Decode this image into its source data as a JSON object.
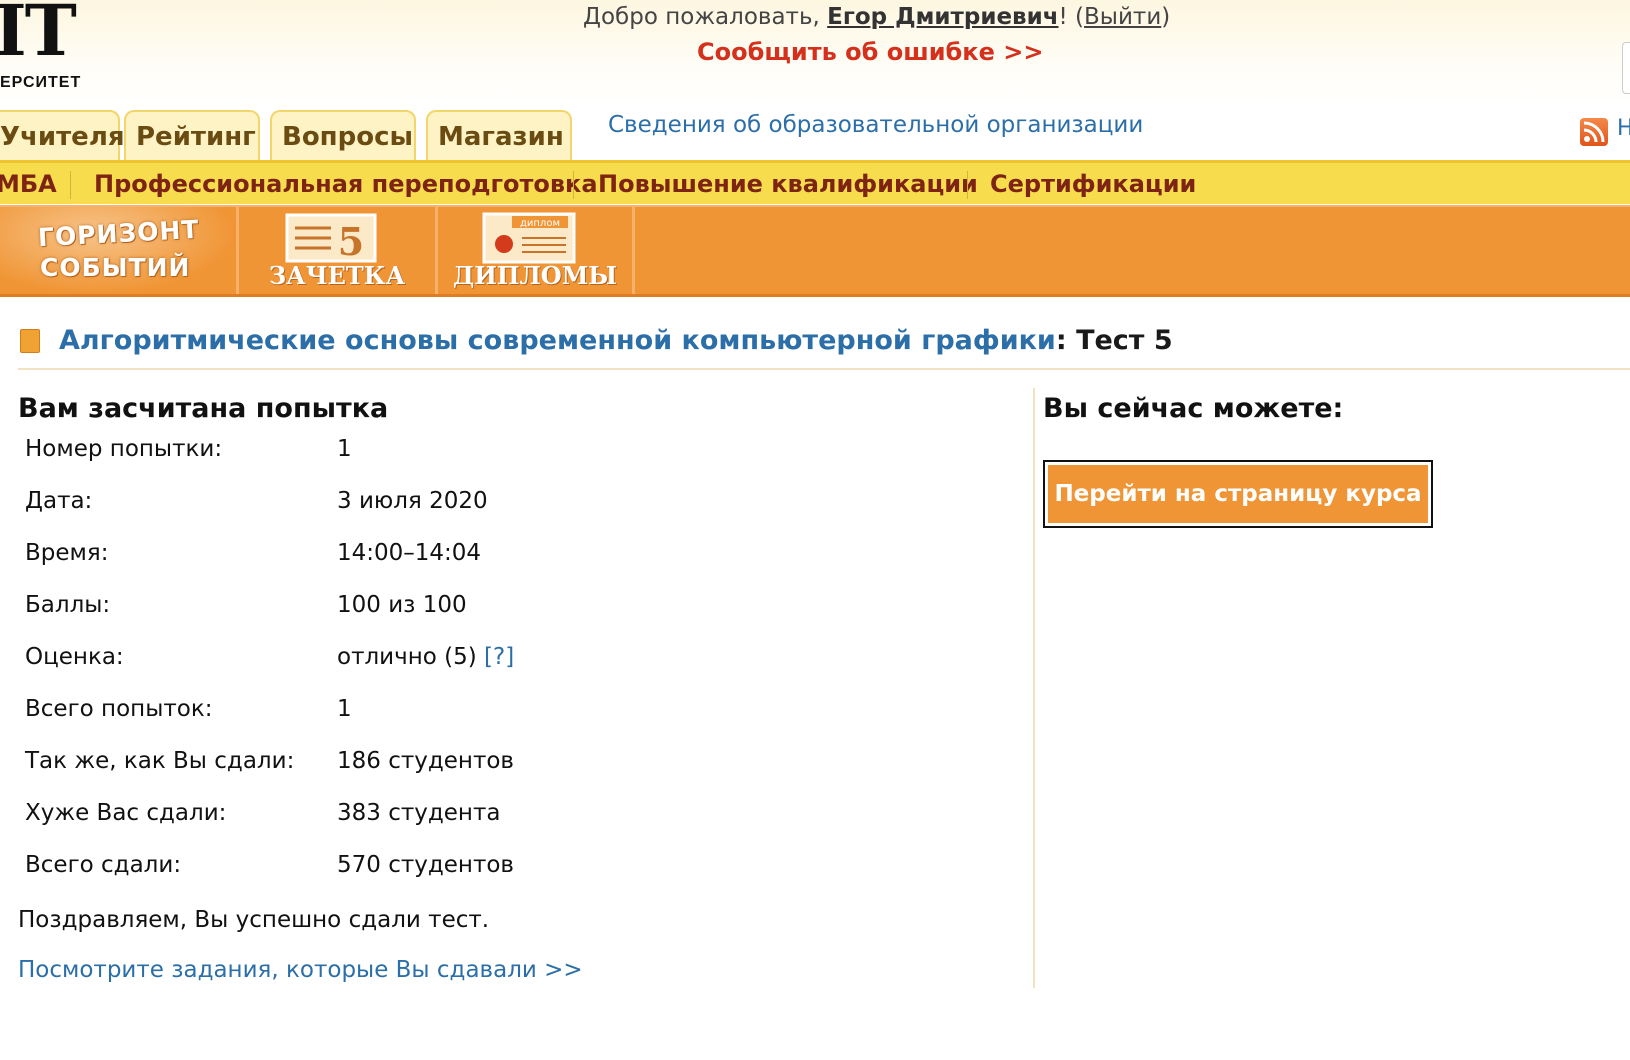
{
  "header": {
    "logo_big": "IT",
    "logo_small": "ЕРСИТЕТ",
    "welcome_prefix": "Добро пожаловать, ",
    "user_name": "Егор Дмитриевич",
    "welcome_mid": "! (",
    "logout_label": "Выйти",
    "welcome_suffix": ")",
    "report_error": "Сообщить об ошибке >>"
  },
  "tabs": [
    {
      "label": "Учителя"
    },
    {
      "label": "Рейтинг"
    },
    {
      "label": "Вопросы"
    },
    {
      "label": "Магазин"
    }
  ],
  "org_info_link": "Сведения об образовательной организации",
  "right_cut_letter": "Н",
  "yellow_nav": [
    {
      "label": "МБА"
    },
    {
      "label": "Профессиональная переподготовка"
    },
    {
      "label": "Повышение квалификации"
    },
    {
      "label": "Сертификации"
    }
  ],
  "orange_nav": {
    "horizon_line1": "ГОРИЗОНТ",
    "horizon_line2": "СОБЫТИЙ",
    "zachetka": "ЗАЧЕТКА",
    "zachetka_grade": "5",
    "diplomas": "ДИПЛОМЫ",
    "diploma_badge": "диплом"
  },
  "page_title": {
    "course": "Алгоритмические основы современной компьютерной графики",
    "separator": ": ",
    "test": "Тест 5"
  },
  "attempt": {
    "heading": "Вам засчитана попытка",
    "rows": [
      {
        "label": "Номер попытки:",
        "value": "1"
      },
      {
        "label": "Дата:",
        "value": "3 июля 2020"
      },
      {
        "label": "Время:",
        "value": "14:00–14:04"
      },
      {
        "label": "Баллы:",
        "value": "100 из 100"
      },
      {
        "label": "Оценка:",
        "value": "отлично (5) "
      },
      {
        "label": "Всего попыток:",
        "value": "1"
      },
      {
        "label": "Так же, как Вы сдали:",
        "value": "186 студентов"
      },
      {
        "label": "Хуже Вас сдали:",
        "value": "383 студента"
      },
      {
        "label": "Всего сдали:",
        "value": "570 студентов"
      }
    ],
    "grade_help": "[?]",
    "congrats": "Поздравляем, Вы успешно сдали тест.",
    "view_tasks": "Посмотрите задания, которые Вы сдавали >>"
  },
  "actions": {
    "heading": "Вы сейчас можете:",
    "go_course": "Перейти на страницу курса"
  },
  "colors": {
    "orange": "#f09535",
    "yellow": "#f7dd4d",
    "link_blue": "#2c6fa8",
    "error_red": "#d4301c",
    "nav_dark_red": "#7e2414"
  }
}
